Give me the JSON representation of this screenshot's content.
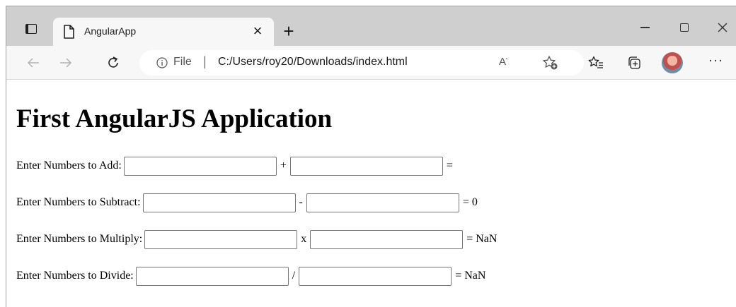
{
  "browser": {
    "tab_title": "AngularApp",
    "tab_close_glyph": "×",
    "new_tab_glyph": "+",
    "address": {
      "scheme_label": "File",
      "separator": "|",
      "url": "C:/Users/roy20/Downloads/index.html",
      "read_aloud_glyph": "A",
      "read_aloud_sup": "˞"
    },
    "more_glyph": "···"
  },
  "page": {
    "heading": "First AngularJS Application",
    "rows": [
      {
        "label": "Enter Numbers to Add:",
        "operator": "+",
        "result": "=",
        "first_value": "",
        "second_value": ""
      },
      {
        "label": "Enter Numbers to Subtract:",
        "operator": "-",
        "result": "= 0",
        "first_value": "",
        "second_value": ""
      },
      {
        "label": "Enter Numbers to Multiply:",
        "operator": "x",
        "result": "= NaN",
        "first_value": "",
        "second_value": ""
      },
      {
        "label": "Enter Numbers to Divide:",
        "operator": "/",
        "result": "= NaN",
        "first_value": "",
        "second_value": ""
      }
    ]
  },
  "icons": {
    "tab_actions": "tab-actions-icon",
    "page": "page-icon",
    "back": "back-arrow-icon",
    "forward": "forward-arrow-icon",
    "reload": "reload-icon",
    "info": "info-icon",
    "read_aloud": "read-aloud-icon",
    "add_favorite": "add-favorite-icon",
    "favorites": "favorites-icon",
    "collections": "collections-icon",
    "profile": "profile-avatar",
    "more": "more-icon",
    "minimize": "minimize-icon",
    "maximize": "maximize-icon",
    "close": "close-icon"
  }
}
